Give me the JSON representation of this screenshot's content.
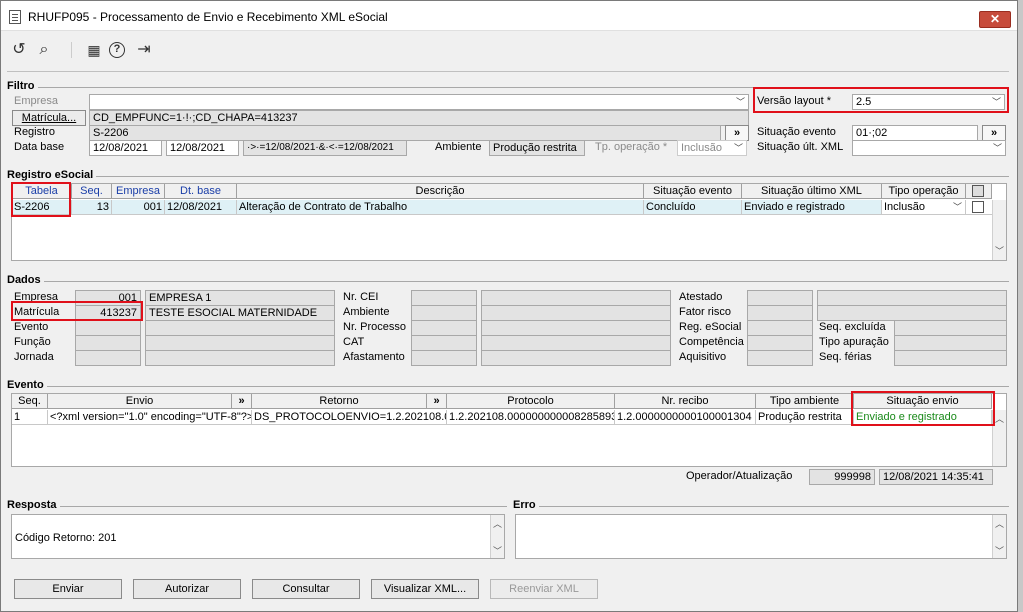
{
  "window": {
    "title": "RHUFP095 - Processamento de Envio e Recebimento XML eSocial",
    "close": "✕"
  },
  "toolbar": {
    "undo": "↺",
    "search": "⌕",
    "calendar": "▦",
    "help": "?",
    "exit": "⇥"
  },
  "filtro": {
    "title": "Filtro",
    "empresa_label": "Empresa",
    "empresa_value": "",
    "matricula_button": "Matrícula...",
    "matricula_value": "CD_EMPFUNC=1·!·;CD_CHAPA=413237",
    "registro_label": "Registro",
    "registro_value": "S-2206",
    "data_base_label": "Data base",
    "date_from": "12/08/2021",
    "date_to": "12/08/2021",
    "date_filter": "·>·=12/08/2021·&·<·=12/08/2021",
    "ambiente_label": "Ambiente",
    "ambiente_value": "Produção restrita",
    "tp_operacao_label": "Tp. operação *",
    "tp_operacao_value": "Inclusão",
    "versao_label": "Versão layout *",
    "versao_value": "2.5",
    "situacao_evento_label": "Situação evento",
    "situacao_evento_value": "01·;02",
    "situacao_xml_label": "Situação últ. XML",
    "situacao_xml_value": "",
    "more": "»"
  },
  "registro": {
    "title": "Registro eSocial",
    "headers": [
      "Tabela",
      "Seq.",
      "Empresa",
      "Dt. base",
      "Descrição",
      "Situação evento",
      "Situação último XML",
      "Tipo operação"
    ],
    "row": {
      "tabela": "S-2206",
      "seq": "13",
      "empresa": "001",
      "dt_base": "12/08/2021",
      "descricao": "Alteração de Contrato de Trabalho",
      "situacao_evento": "Concluído",
      "situacao_xml": "Enviado e registrado",
      "tipo_operacao": "Inclusão"
    }
  },
  "dados": {
    "title": "Dados",
    "empresa_label": "Empresa",
    "empresa_code": "001",
    "empresa_name": "EMPRESA 1",
    "matricula_label": "Matrícula",
    "matricula_code": "413237",
    "matricula_name": "TESTE ESOCIAL MATERNIDADE",
    "evento_label": "Evento",
    "funcao_label": "Função",
    "jornada_label": "Jornada",
    "nr_cei_label": "Nr. CEI",
    "ambiente_label": "Ambiente",
    "nr_processo_label": "Nr. Processo",
    "cat_label": "CAT",
    "afastamento_label": "Afastamento",
    "atestado_label": "Atestado",
    "fator_risco_label": "Fator risco",
    "reg_esocial_label": "Reg. eSocial",
    "competencia_label": "Competência",
    "aquisitivo_label": "Aquisitivo",
    "seq_excluida_label": "Seq. excluída",
    "tipo_apuracao_label": "Tipo apuração",
    "seq_ferias_label": "Seq. férias"
  },
  "evento": {
    "title": "Evento",
    "headers": [
      "Seq.",
      "Envio",
      "»",
      "Retorno",
      "»",
      "Protocolo",
      "Nr. recibo",
      "Tipo ambiente",
      "Situação envio"
    ],
    "row": {
      "seq": "1",
      "envio": "<?xml version=\"1.0\" encoding=\"UTF-8\"?>",
      "retorno": "DS_PROTOCOLOENVIO=1.2.202108.000",
      "protocolo": "1.2.202108.0000000000082858935",
      "recibo": "1.2.0000000000100001304",
      "tipo_ambiente": "Produção restrita",
      "situacao_envio": "Enviado e registrado"
    },
    "operador_label": "Operador/Atualização",
    "operador_value": "999998",
    "atualizacao_value": "12/08/2021 14:35:41"
  },
  "resposta": {
    "title": "Resposta",
    "text": "Código Retorno: 201"
  },
  "erro": {
    "title": "Erro",
    "text": ""
  },
  "buttons": {
    "enviar": "Enviar",
    "autorizar": "Autorizar",
    "consultar": "Consultar",
    "visualizar": "Visualizar XML...",
    "reenviar": "Reenviar XML"
  },
  "colors": {
    "highlight": "#e0101a",
    "status_green": "#1a8a1a",
    "header_blue": "#1a3ea8",
    "row_selected": "#dff1f6"
  }
}
